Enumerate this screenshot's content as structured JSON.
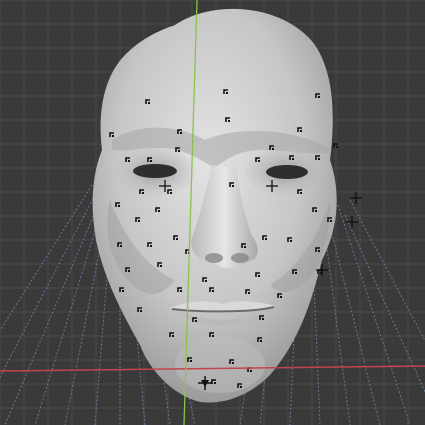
{
  "viewport": {
    "background_color": "#3a3a3a",
    "grid_color": "#4a4a4a",
    "x_axis_color": "#c1444e",
    "y_axis_color": "#8bc34a",
    "projection_lines_color": "#6f8fb8",
    "mesh_color": "#c9c9c9",
    "marker_color": "#111111"
  },
  "objects": [
    {
      "name": "face-mesh",
      "type": "sculpt",
      "shading": "solid-gray"
    }
  ],
  "tracking_markers": {
    "style": "corner-brackets",
    "visible": true
  },
  "icons": [
    "3d-cursor-icon"
  ]
}
